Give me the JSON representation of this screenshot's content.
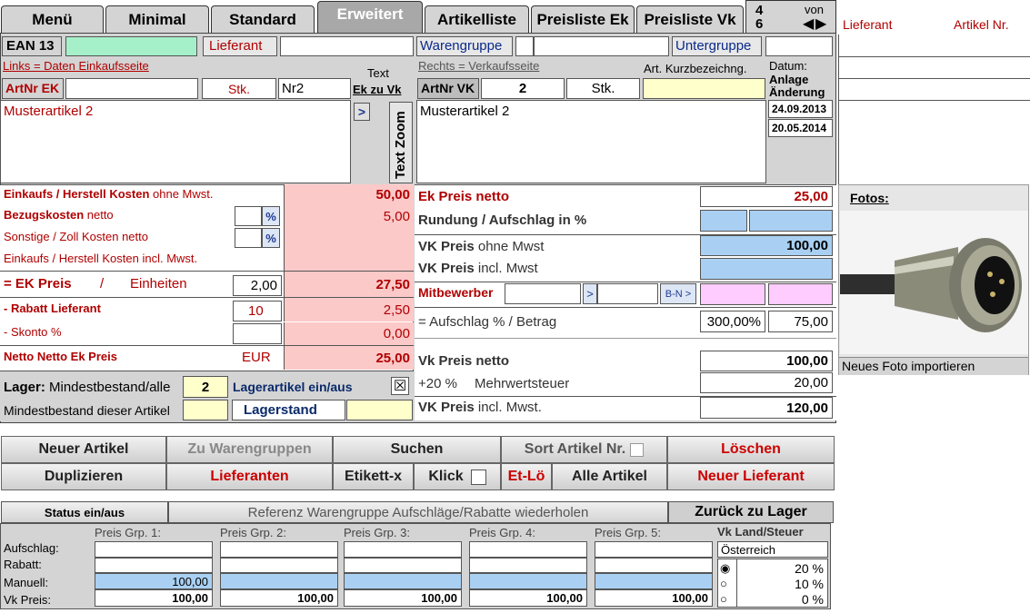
{
  "tabs": [
    "Menü",
    "Minimal",
    "Standard",
    "Erweitert",
    "Artikelliste",
    "Preisliste Ek",
    "Preisliste Vk"
  ],
  "pager": {
    "current": "4",
    "total": "6",
    "von": "von"
  },
  "side": {
    "lieferant": "Lieferant",
    "artikel_nr": "Artikel Nr.",
    "fotos": "Fotos:",
    "import": "Neues Foto importieren"
  },
  "top": {
    "ean": "EAN 13",
    "lieferant": "Lieferant",
    "warengruppe": "Warengruppe",
    "untergruppe": "Untergruppe"
  },
  "left": {
    "links": "Links = Daten Einkaufsseite",
    "text": "Text",
    "ek_zu_vk": "Ek zu Vk",
    "artnr_ek": "ArtNr EK",
    "stk": "Stk.",
    "stk_value": "Nr2",
    "description": "Musterartikel 2",
    "arrow": ">",
    "text_zoom": "Text Zoom",
    "einkauf_a": "Einkaufs / Herstell Kosten",
    "einkauf_b": " ohne Mwst.",
    "einkauf_value": "50,00",
    "bezug_a": "Bezugskosten",
    "bezug_b": " netto",
    "pct": "%",
    "bezug_value": "5,00",
    "sonstige": "Sonstige / Zoll Kosten netto",
    "einkauf_incl": "Einkaufs / Herstell Kosten incl. Mwst.",
    "ek_preis": "= EK Preis",
    "slash": "/",
    "einheiten": "Einheiten",
    "einheiten_value": "2,00",
    "ek_preis_value": "27,50",
    "rabatt": "- Rabatt Lieferant",
    "rabatt_pct": "10",
    "rabatt_value": "2,50",
    "skonto": "- Skonto %",
    "skonto_value": "0,00",
    "netto": "Netto Netto Ek Preis",
    "eur": "EUR",
    "netto_value": "25,00",
    "lager_a": "Lager:",
    "lager_b": " Mindestbestand/alle",
    "lager_value": "2",
    "lagerartikel": "Lagerartikel ein/aus",
    "mindest": "Mindestbestand dieser Artikel",
    "lagerstand": "Lagerstand"
  },
  "right": {
    "rechts": "Rechts = Verkaufsseite",
    "kurz": "Art. Kurzbezeichng.",
    "artnr_vk": "ArtNr VK",
    "artnr_vk_value": "2",
    "stk": "Stk.",
    "datum": "Datum:",
    "anlage": "Anlage",
    "aenderung": "Änderung",
    "date1": "24.09.2013",
    "date2": "20.05.2014",
    "description": "Musterartikel 2",
    "ek_netto": "Ek Preis netto",
    "ek_netto_value": "25,00",
    "rundung_a": "Rundung",
    "rundung_b": " / Aufschlag in %",
    "vk_ohne_a": "VK Preis",
    "vk_ohne_b": " ohne Mwst",
    "vk_ohne_value": "100,00",
    "vk_incl_a": "VK Preis",
    "vk_incl_b": " incl. Mwst",
    "mitbewerber": "Mitbewerber",
    "arrow": ">",
    "bn": "B-N >",
    "aufschlag": "= Aufschlag % / Betrag",
    "aufschlag_pct": "300,00%",
    "aufschlag_value": "75,00",
    "vk_netto": "Vk Preis netto",
    "vk_netto_value": "100,00",
    "mwst_rate": "+20 %",
    "mwst_label": "Mehrwertsteuer",
    "mwst_value": "20,00",
    "vk_total_a": "VK Preis",
    "vk_total_b": " incl. Mwst.",
    "vk_total_value": "120,00"
  },
  "buttons": {
    "neuer_artikel": "Neuer Artikel",
    "zu_warengruppen": "Zu Warengruppen",
    "suchen": "Suchen",
    "sort": "Sort Artikel Nr.",
    "loeschen": "Löschen",
    "duplizieren": "Duplizieren",
    "lieferanten": "Lieferanten",
    "etikett": "Etikett-x",
    "klick": "Klick",
    "etlo": "Et-Lö",
    "alle": "Alle Artikel",
    "neuer_lieferant": "Neuer Lieferant"
  },
  "status": {
    "status": "Status ein/aus",
    "referenz": "Referenz Warengruppe Aufschläge/Rabatte wiederholen",
    "zurueck": "Zurück zu Lager"
  },
  "groups": {
    "row_labels": [
      "Aufschlag:",
      "Rabatt:",
      "Manuell:",
      "Vk Preis:"
    ],
    "headers": [
      "Preis Grp. 1:",
      "Preis Grp. 2:",
      "Preis Grp. 3:",
      "Preis Grp. 4:",
      "Preis Grp. 5:"
    ],
    "manuell": [
      "100,00",
      "",
      "",
      "",
      ""
    ],
    "vk": [
      "100,00",
      "100,00",
      "100,00",
      "100,00",
      "100,00"
    ]
  },
  "vat": {
    "title": "Vk Land/Steuer",
    "country": "Österreich",
    "rates": [
      "20 %",
      "10 %",
      "0 %"
    ]
  },
  "colors": {
    "accent_red": "#b00000",
    "pink": "#fcc9c9",
    "blue": "#a9d0f2",
    "yellow": "#ffffcc"
  }
}
